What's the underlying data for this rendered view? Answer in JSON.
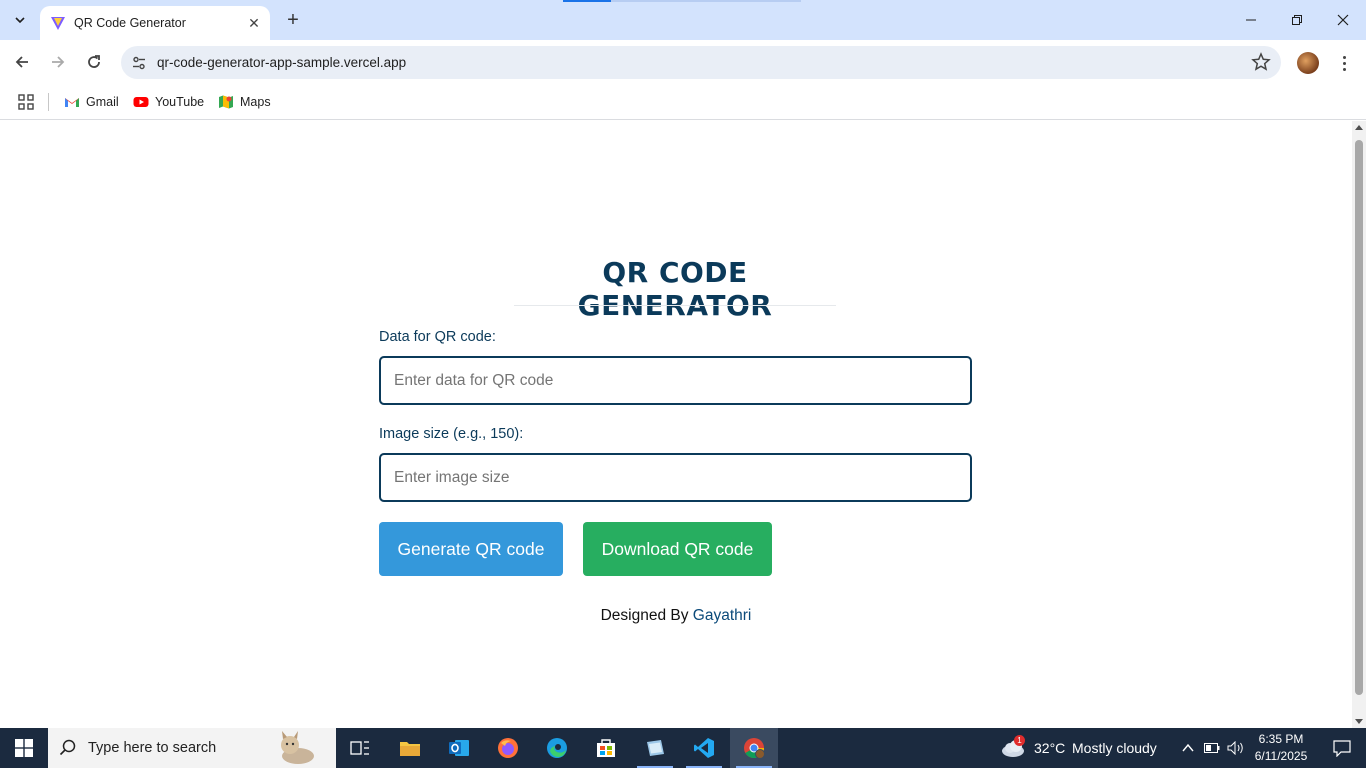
{
  "browser": {
    "tab_title": "QR Code Generator",
    "url": "qr-code-generator-app-sample.vercel.app",
    "bookmarks": [
      {
        "label": "Gmail",
        "icon": "gmail-icon"
      },
      {
        "label": "YouTube",
        "icon": "youtube-icon"
      },
      {
        "label": "Maps",
        "icon": "maps-icon"
      }
    ]
  },
  "page": {
    "heading": "QR CODE GENERATOR",
    "data_label": "Data for QR code:",
    "data_placeholder": "Enter data for QR code",
    "size_label": "Image size (e.g., 150):",
    "size_placeholder": "Enter image size",
    "generate_label": "Generate QR code",
    "download_label": "Download QR code",
    "footer_prefix": "Designed By",
    "footer_author": "Gayathri",
    "colors": {
      "heading": "#0b3a5a",
      "generate_button": "#3498db",
      "download_button": "#27ae60"
    }
  },
  "taskbar": {
    "search_placeholder": "Type here to search",
    "weather_temp": "32°C",
    "weather_desc": "Mostly cloudy",
    "weather_badge": "1",
    "time": "6:35 PM",
    "date": "6/11/2025"
  }
}
